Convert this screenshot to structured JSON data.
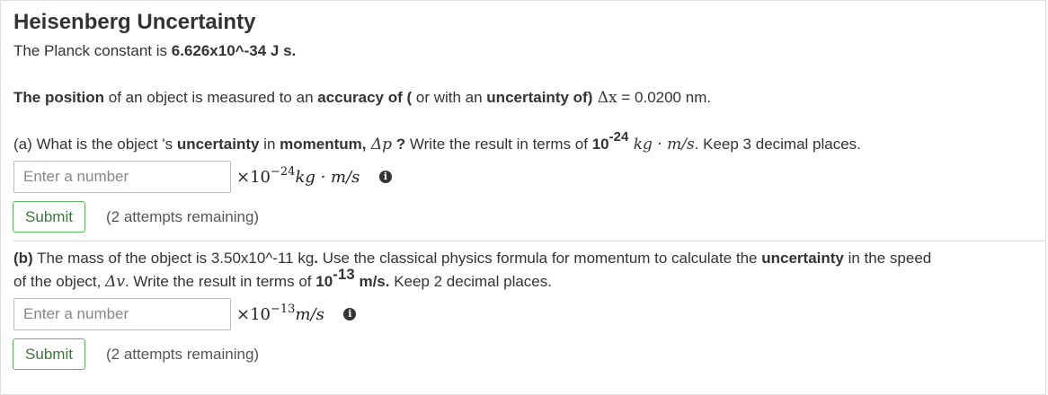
{
  "title": "Heisenberg Uncertainty",
  "intro": {
    "planck_prefix": "The Planck constant is ",
    "planck_value": "6.626x10^-34 J s."
  },
  "statement": {
    "p1": "The position",
    "p2": " of an object  is measured to an ",
    "p3": "accuracy of (",
    "p4": " or with an ",
    "p5": "uncertainty of)",
    "p6": " Δx",
    "p7": " = 0.0200 nm."
  },
  "part_a": {
    "q1": "(a) What is the  object 's ",
    "q2": "uncertainty",
    "q3": " in ",
    "q4": "momentum,",
    "q5": " Δp",
    "q6": " ?",
    "q7": " Write the result in terms of ",
    "q8": "10",
    "q9": "-24",
    "q10": " kg · m/s",
    "q11": ". Keep 3 decimal places.",
    "placeholder": "Enter a number",
    "unit_base": "×10",
    "unit_exp": "−24",
    "unit_text": "kg · m/s",
    "info_icon": "info-icon",
    "submit_label": "Submit",
    "attempts": "(2 attempts remaining)"
  },
  "part_b": {
    "q1": "(b)",
    "q2": " The mass of the object is 3.50x10^-11 kg",
    "q3": ".",
    "q4": " Use the classical physics formula for momentum to calculate the ",
    "q5": "uncertainty",
    "q6": " in the speed",
    "q7": "of the object, ",
    "q8": "Δv",
    "q9": ". Write the result in terms of ",
    "q10": "10",
    "q11": "-13",
    "q12": " m/s.",
    "q13": " Keep 2 decimal places.",
    "placeholder": "Enter a number",
    "unit_base": "×10",
    "unit_exp": "−13",
    "unit_text": "m/s",
    "info_icon": "info-icon",
    "submit_label": "Submit",
    "attempts": "(2 attempts remaining)"
  },
  "colors": {
    "submit_border": "#5cb85c",
    "submit_text": "#3c763d",
    "text": "#333333"
  }
}
